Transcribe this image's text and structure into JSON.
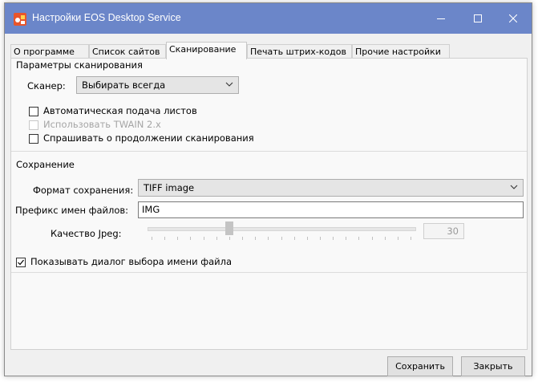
{
  "window": {
    "title": "Настройки EOS Desktop Service",
    "title_bar_color": "#6b86c9"
  },
  "tabs": [
    {
      "label": "О программе"
    },
    {
      "label": "Список сайтов"
    },
    {
      "label": "Сканирование",
      "active": true
    },
    {
      "label": "Печать штрих-кодов"
    },
    {
      "label": "Прочие настройки"
    }
  ],
  "scanning": {
    "group_title": "Параметры сканирования",
    "scanner_label": "Сканер:",
    "scanner_value": "Выбирать всегда",
    "auto_feed_label": "Автоматическая подача листов",
    "auto_feed_checked": false,
    "twain_label": "Использовать TWAIN 2.x",
    "twain_enabled": false,
    "ask_continue_label": "Спрашивать о продолжении сканирования",
    "ask_continue_checked": false
  },
  "saving": {
    "group_title": "Сохранение",
    "format_label": "Формат сохранения:",
    "format_value": "TIFF image",
    "prefix_label": "Префикс имен файлов:",
    "prefix_value": "IMG",
    "jpeg_quality_label": "Качество Jpeg:",
    "jpeg_quality_value": "30",
    "jpeg_slider_fraction": 0.3,
    "show_dialog_label": "Показывать диалог выбора имени файла",
    "show_dialog_checked": true
  },
  "buttons": {
    "save_label": "Сохранить",
    "close_label": "Закрыть"
  }
}
